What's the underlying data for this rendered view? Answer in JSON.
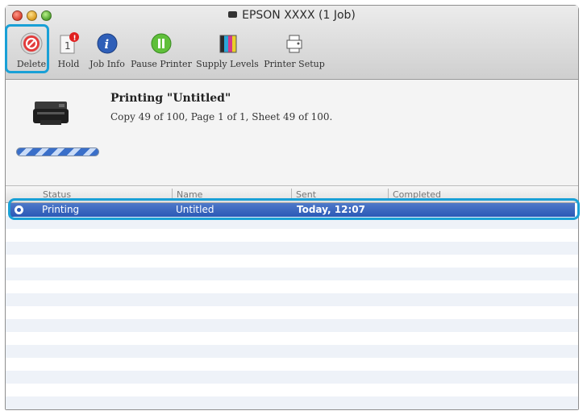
{
  "window": {
    "title": "EPSON XXXX (1 Job)"
  },
  "toolbar": {
    "delete_label": "Delete",
    "hold_label": "Hold",
    "info_label": "Job Info",
    "pause_label": "Pause Printer",
    "supply_label": "Supply Levels",
    "setup_label": "Printer Setup"
  },
  "status": {
    "title": "Printing \"Untitled\"",
    "detail": "Copy 49 of 100, Page 1 of 1, Sheet 49 of 100."
  },
  "columns": {
    "status": "Status",
    "name": "Name",
    "sent": "Sent",
    "completed": "Completed"
  },
  "jobs": [
    {
      "status": "Printing",
      "name": "Untitled",
      "sent": "Today, 12:07",
      "completed": ""
    }
  ],
  "colors": {
    "highlight": "#19a0d6",
    "selection": "#2a58b6"
  }
}
